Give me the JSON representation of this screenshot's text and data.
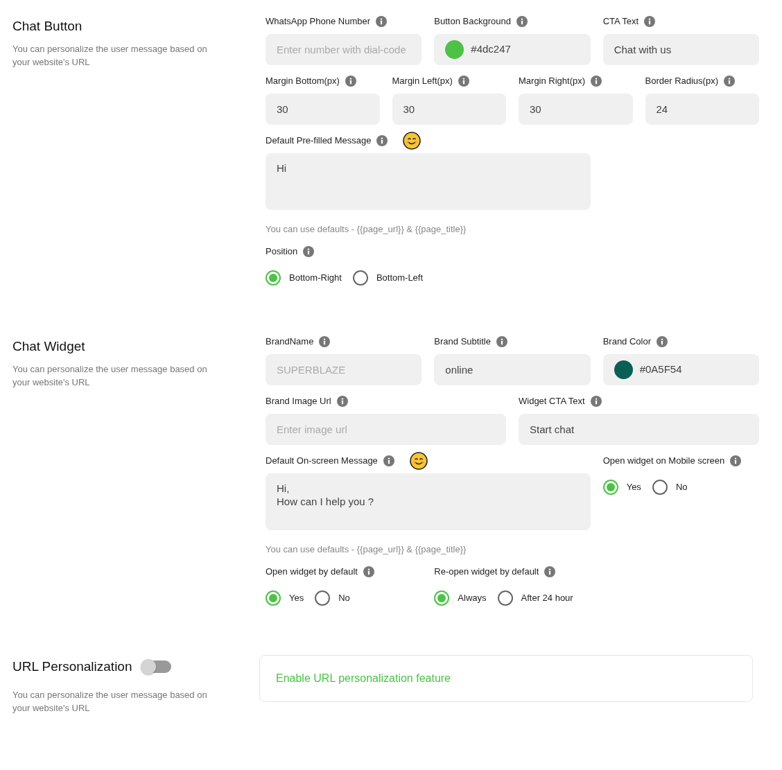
{
  "sections": [
    {
      "title": "Chat Button",
      "description": "You can personalize the user message based on your website's URL",
      "rows": [
        [
          {
            "kind": "input",
            "label": "WhatsApp Phone Number",
            "placeholder": "Enter number with dial-code"
          },
          {
            "kind": "color",
            "label": "Button Background",
            "value": "#4dc247"
          },
          {
            "kind": "input",
            "label": "CTA Text",
            "value": "Chat with us"
          }
        ],
        [
          {
            "kind": "input",
            "label": "Margin Bottom(px)",
            "value": "30"
          },
          {
            "kind": "input",
            "label": "Margin Left(px)",
            "value": "30"
          },
          {
            "kind": "input",
            "label": "Margin Right(px)",
            "value": "30"
          },
          {
            "kind": "input",
            "label": "Border Radius(px)",
            "value": "24"
          }
        ],
        [
          {
            "kind": "textarea",
            "label": "Default Pre-filled Message",
            "emoji_picker": true,
            "value": "Hi",
            "hint": "You can use defaults - {{page_url}} & {{page_title}}"
          },
          "",
          ""
        ],
        [
          {
            "kind": "radio",
            "label": "Position",
            "options": [
              {
                "label": "Bottom-Right",
                "selected": true
              },
              {
                "label": "Bottom-Left",
                "selected": false
              }
            ]
          }
        ]
      ]
    },
    {
      "title": "Chat Widget",
      "description": "You can personalize the user message based on your website's URL",
      "rows": [
        [
          {
            "kind": "input",
            "label": "BrandName",
            "placeholder": "SUPERBLAZE"
          },
          {
            "kind": "input",
            "label": "Brand Subtitle",
            "value": "online"
          },
          {
            "kind": "color",
            "label": "Brand Color",
            "value": "#0A5F54"
          }
        ],
        [
          {
            "kind": "input",
            "label": "Brand Image Url",
            "placeholder": "Enter image url"
          },
          {
            "kind": "input",
            "label": "Widget CTA Text",
            "value": "Start chat"
          }
        ],
        [
          {
            "kind": "textarea",
            "label": "Default On-screen Message",
            "emoji_picker": true,
            "value": "Hi,\nHow can I help you ?",
            "hint": "You can use defaults - {{page_url}} & {{page_title}}"
          },
          "",
          {
            "kind": "radio",
            "label": "Open widget on Mobile screen",
            "options": [
              {
                "label": "Yes",
                "selected": true
              },
              {
                "label": "No",
                "selected": false
              }
            ]
          }
        ],
        [
          {
            "kind": "radio",
            "label": "Open widget by default",
            "options": [
              {
                "label": "Yes",
                "selected": true
              },
              {
                "label": "No",
                "selected": false
              }
            ]
          },
          {
            "kind": "radio",
            "label": "Re-open widget by default",
            "options": [
              {
                "label": "Always",
                "selected": true
              },
              {
                "label": "After 24 hour",
                "selected": false
              }
            ]
          },
          ""
        ]
      ]
    }
  ],
  "url_personalization": {
    "title": "URL Personalization",
    "on": false,
    "description": "You can personalize the user message based on your website's URL",
    "card_text": "Enable URL personalization feature"
  }
}
